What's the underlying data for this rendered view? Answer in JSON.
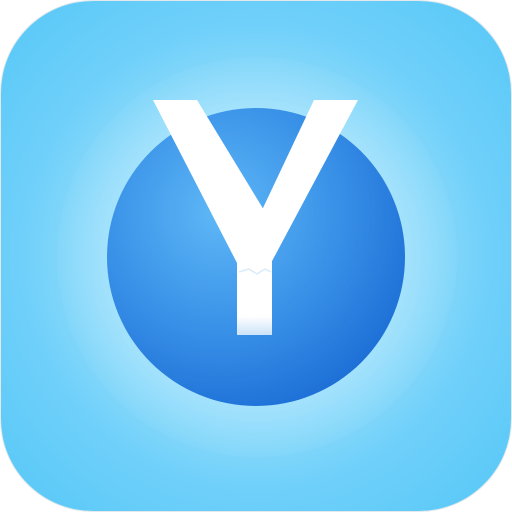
{
  "app_icon": {
    "logo_letter": "Y",
    "icon": "sphere-y-logo-icon",
    "colors": {
      "background_outer": "#56c7f7",
      "background_inner": "#c4eefd",
      "sphere_light": "#56b2f5",
      "sphere_dark": "#1d6fd6",
      "letter": "#ffffff"
    }
  }
}
